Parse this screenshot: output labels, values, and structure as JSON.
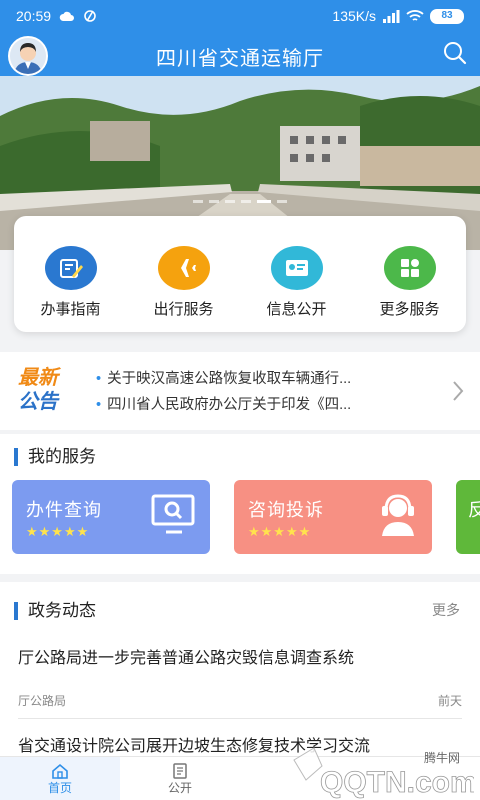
{
  "status_bar": {
    "time": "20:59",
    "network_speed": "135K/s",
    "battery": "83"
  },
  "header": {
    "title": "四川省交通运输厅"
  },
  "quick_actions": [
    {
      "label": "办事指南",
      "icon": "document-edit-icon",
      "color": "#2a78d0"
    },
    {
      "label": "出行服务",
      "icon": "airplane-icon",
      "color": "#f5a20e"
    },
    {
      "label": "信息公开",
      "icon": "id-card-icon",
      "color": "#31b8d8"
    },
    {
      "label": "更多服务",
      "icon": "grid-icon",
      "color": "#4cb84a"
    }
  ],
  "notice": {
    "logo_line1": "最新",
    "logo_line2": "公告",
    "items": [
      "关于映汉高速公路恢复收取车辆通行...",
      "四川省人民政府办公厅关于印发《四..."
    ]
  },
  "services": {
    "title": "我的服务",
    "cards": [
      {
        "name": "办件查询",
        "stars": "★★★★★",
        "color": "#7c9bf0"
      },
      {
        "name": "咨询投诉",
        "stars": "★★★★★",
        "color": "#f79083"
      },
      {
        "name": "反",
        "color": "#5fb83a"
      }
    ]
  },
  "news": {
    "title": "政务动态",
    "more_label": "更多",
    "items": [
      {
        "title": "厅公路局进一步完善普通公路灾毁信息调查系统",
        "source": "厅公路局",
        "time": "前天"
      },
      {
        "title": "省交通设计院公司展开边坡生态修复技术学习交流"
      }
    ]
  },
  "bottom_nav": [
    {
      "label": "首页",
      "icon": "home-icon",
      "active": true
    },
    {
      "label": "公开",
      "icon": "notepad-icon",
      "active": false
    },
    {
      "label": "",
      "icon": "",
      "active": false
    },
    {
      "label": "",
      "icon": "",
      "active": false
    }
  ],
  "watermark": {
    "text1": "腾牛网",
    "text2": "QQTN.com"
  }
}
